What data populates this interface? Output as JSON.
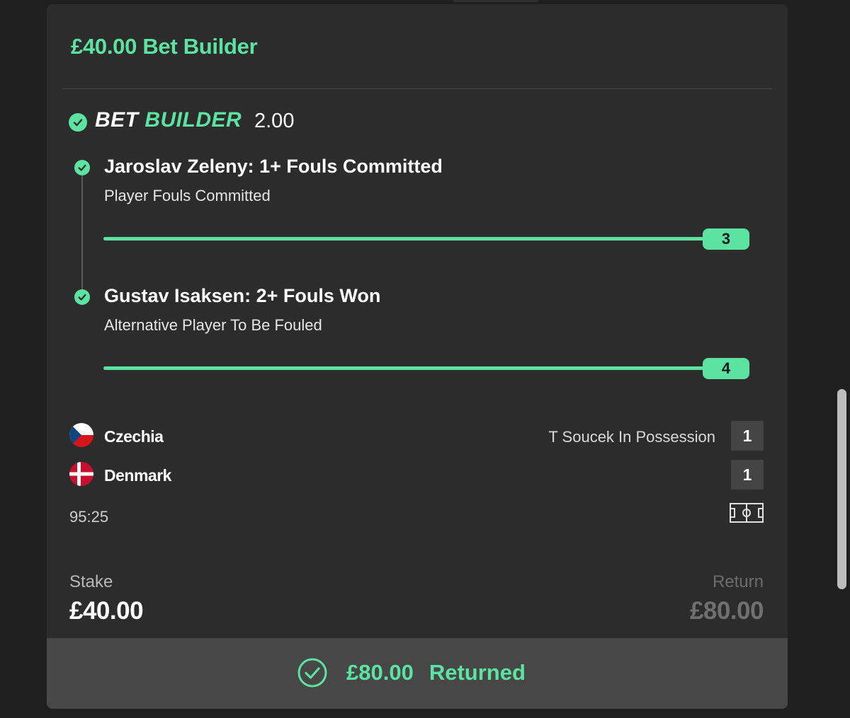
{
  "header": {
    "title": "£40.00 Bet Builder"
  },
  "bet_builder": {
    "label_bet": "BET",
    "label_builder": "BUILDER",
    "odds": "2.00"
  },
  "legs": [
    {
      "title": "Jaroslav Zeleny: 1+ Fouls Committed",
      "market": "Player Fouls Committed",
      "progress_value": "3",
      "progress_fraction": 1.0
    },
    {
      "title": "Gustav Isaksen: 2+ Fouls Won",
      "market": "Alternative Player To Be Fouled",
      "progress_value": "4",
      "progress_fraction": 1.0
    }
  ],
  "match": {
    "home": {
      "name": "Czechia",
      "score": "1",
      "flag_icon": "czech-flag-icon"
    },
    "away": {
      "name": "Denmark",
      "score": "1",
      "flag_icon": "denmark-flag-icon"
    },
    "possession_text": "T Soucek In Possession",
    "clock": "95:25"
  },
  "stake": {
    "label": "Stake",
    "value": "£40.00"
  },
  "return": {
    "label": "Return",
    "value": "£80.00"
  },
  "result": {
    "amount": "£80.00",
    "status": "Returned"
  },
  "colors": {
    "accent": "#5ce3a2",
    "card_bg": "#2c2c2c",
    "footer_bg": "#474747",
    "page_bg": "#1f1f1f"
  }
}
